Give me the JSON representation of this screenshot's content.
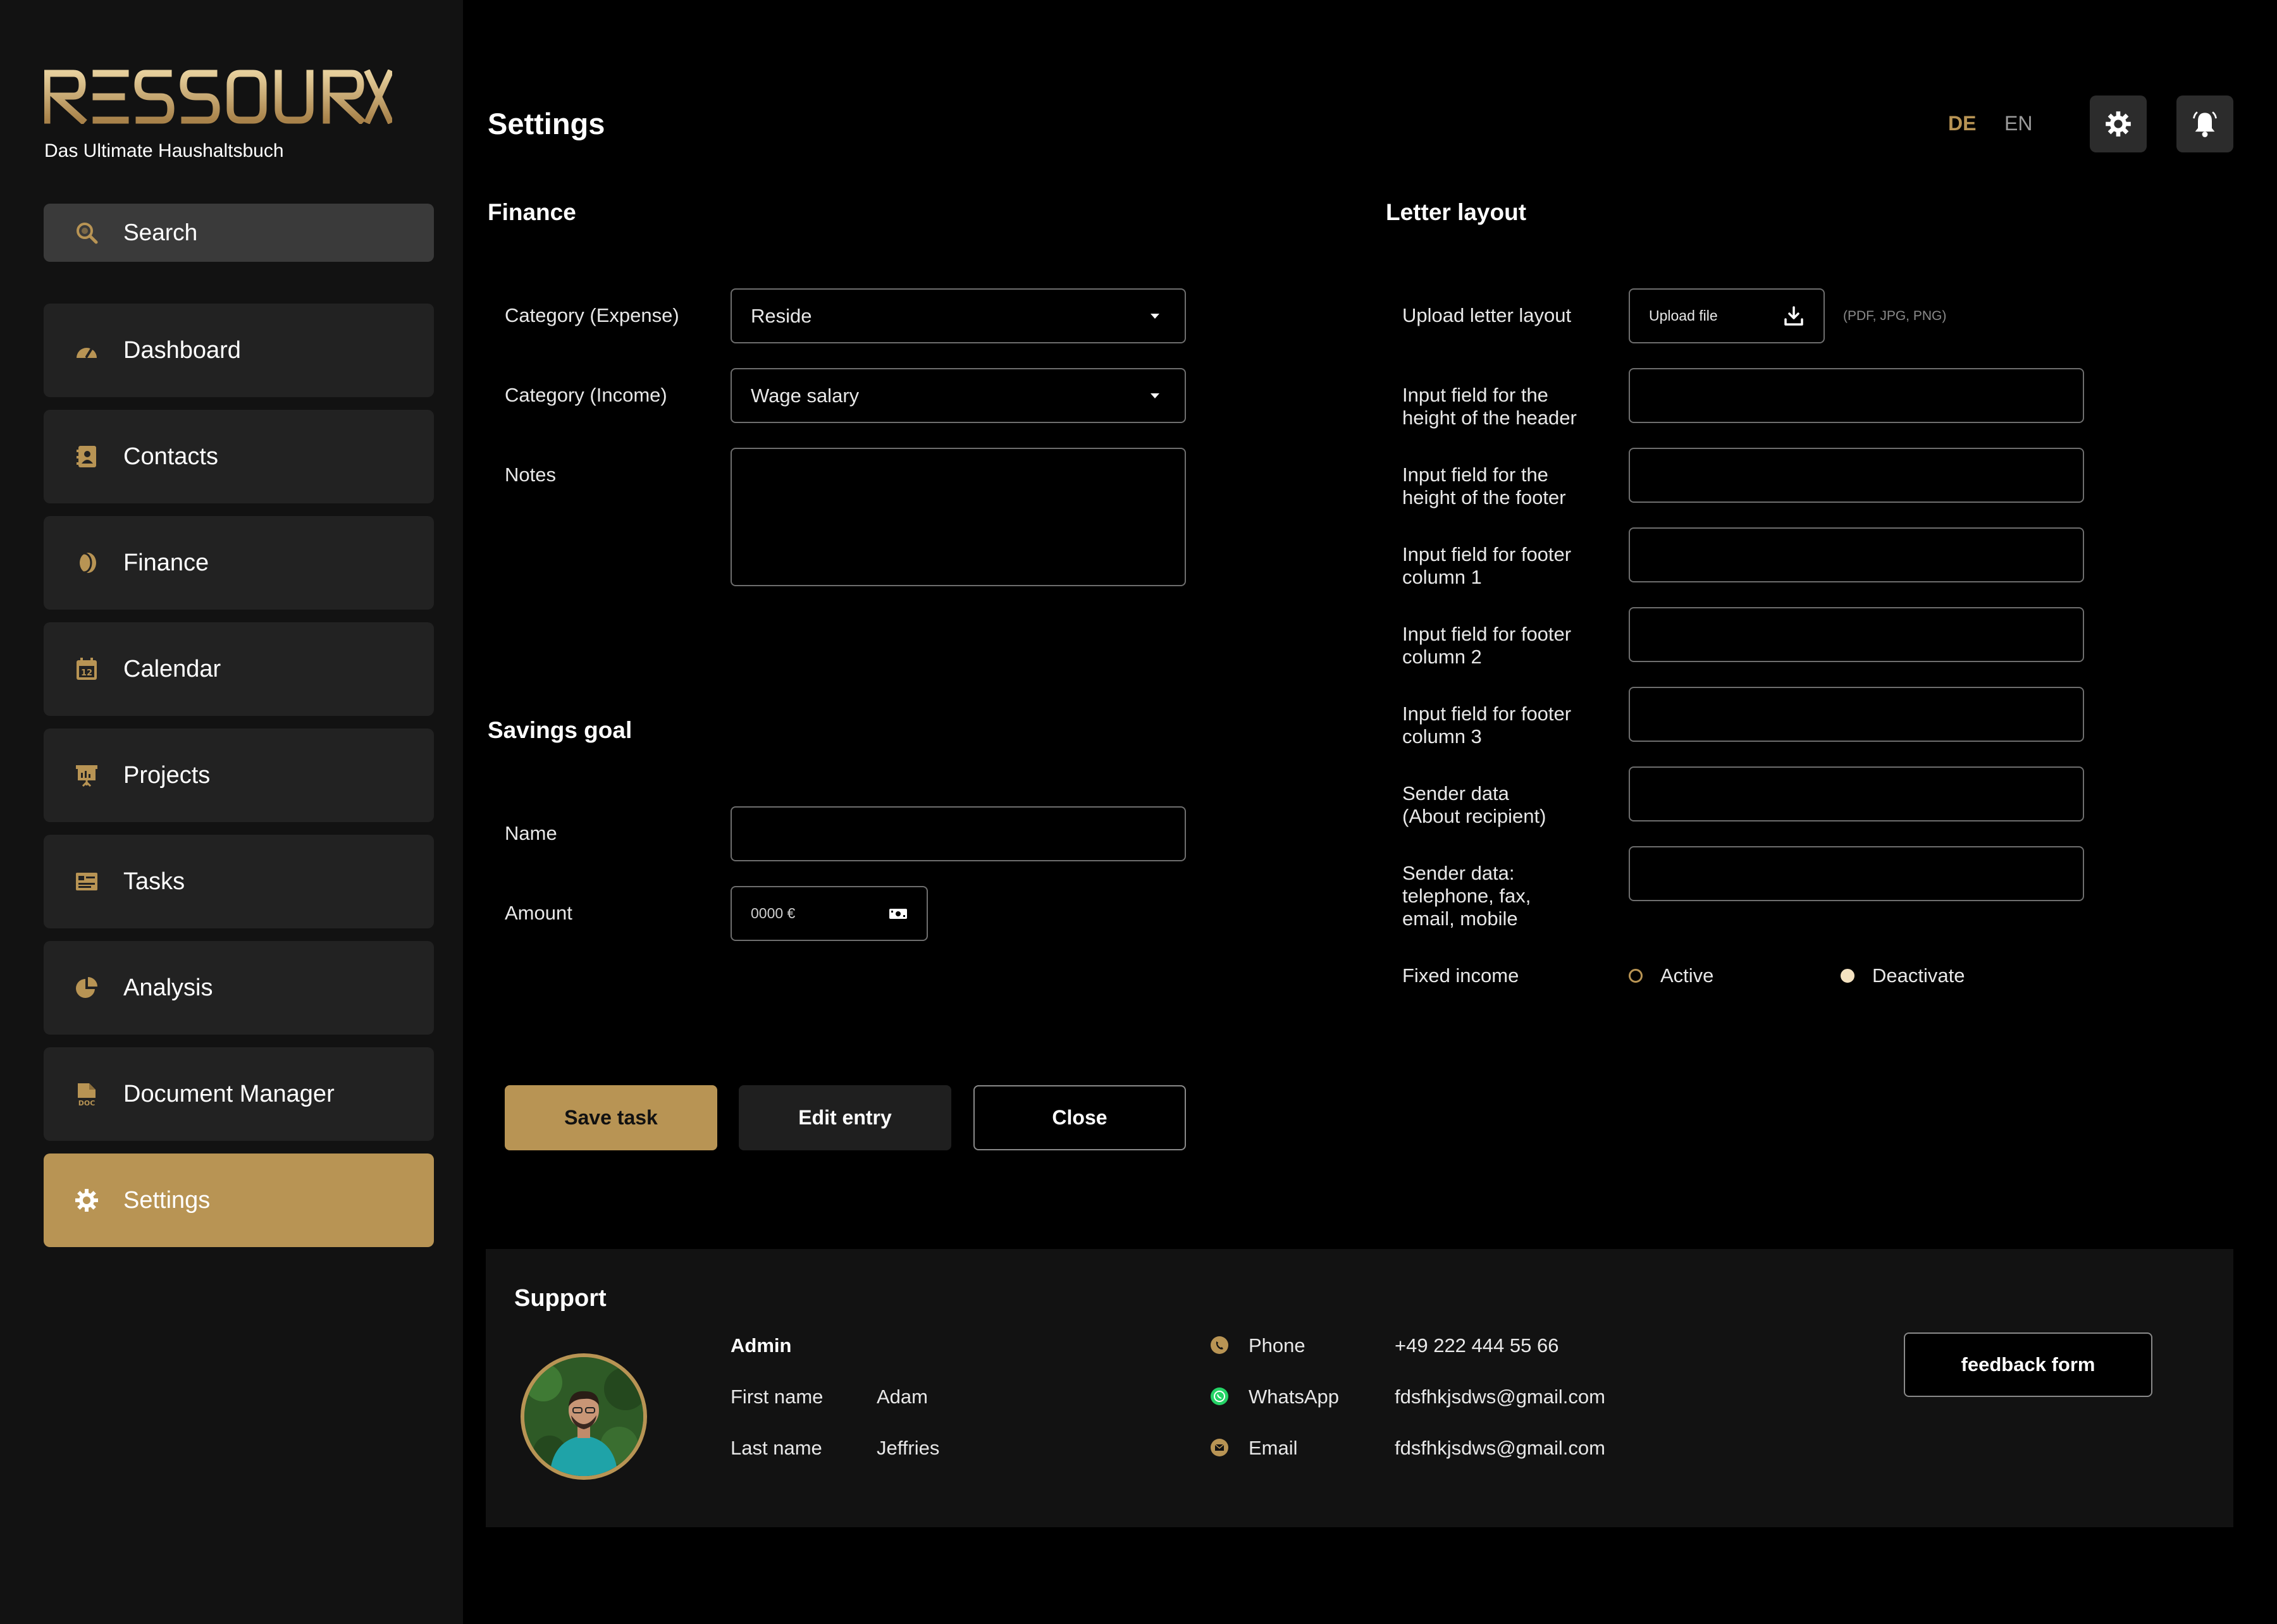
{
  "brand": {
    "logo_text": "RESSOURX",
    "tagline": "Das Ultimate Haushaltsbuch",
    "accent": "#b89454"
  },
  "sidebar": {
    "search_label": "Search",
    "items": [
      {
        "label": "Dashboard",
        "icon": "gauge-icon"
      },
      {
        "label": "Contacts",
        "icon": "contact-book-icon"
      },
      {
        "label": "Finance",
        "icon": "coins-icon"
      },
      {
        "label": "Calendar",
        "icon": "calendar-icon"
      },
      {
        "label": "Projects",
        "icon": "presentation-board-icon"
      },
      {
        "label": "Tasks",
        "icon": "task-list-icon"
      },
      {
        "label": "Analysis",
        "icon": "pie-chart-icon"
      },
      {
        "label": "Document Manager",
        "icon": "document-icon"
      },
      {
        "label": "Settings",
        "icon": "gear-icon",
        "active": true
      }
    ]
  },
  "header": {
    "title": "Settings",
    "lang_de": "DE",
    "lang_en": "EN",
    "active_lang": "DE"
  },
  "finance": {
    "title": "Finance",
    "category_expense_label": "Category (Expense)",
    "category_expense_value": "Reside",
    "category_income_label": "Category (Income)",
    "category_income_value": "Wage salary",
    "notes_label": "Notes"
  },
  "savings": {
    "title": "Savings goal",
    "name_label": "Name",
    "amount_label": "Amount",
    "amount_placeholder": "0000 €"
  },
  "letter": {
    "title": "Letter layout",
    "upload_label": "Upload letter layout",
    "upload_button": "Upload file",
    "upload_hint": "(PDF, JPG, PNG)",
    "fields": [
      {
        "line1": "Input field for the",
        "line2": "height of the header",
        "line3": ""
      },
      {
        "line1": "Input field for the",
        "line2": "height of the footer",
        "line3": ""
      },
      {
        "line1": "Input field for footer",
        "line2": "column 1",
        "line3": ""
      },
      {
        "line1": "Input field for footer",
        "line2": "column 2",
        "line3": ""
      },
      {
        "line1": "Input field for footer",
        "line2": "column 3",
        "line3": ""
      },
      {
        "line1": "Sender data",
        "line2": "(About recipient)",
        "line3": ""
      },
      {
        "line1": "Sender data:",
        "line2": "telephone, fax,",
        "line3": "email, mobile"
      }
    ],
    "fixed_income_label": "Fixed income",
    "radio_active": "Active",
    "radio_deactivate": "Deactivate",
    "selected": "Deactivate"
  },
  "actions": {
    "save": "Save task",
    "edit": "Edit entry",
    "close": "Close"
  },
  "support": {
    "title": "Support",
    "role": "Admin",
    "first_name_label": "First name",
    "first_name": "Adam",
    "last_name_label": "Last name",
    "last_name": "Jeffries",
    "phone_label": "Phone",
    "phone": "+49 222 444 55 66",
    "whatsapp_label": "WhatsApp",
    "whatsapp": "fdsfhkjsdws@gmail.com",
    "email_label": "Email",
    "email": "fdsfhkjsdws@gmail.com",
    "feedback": "feedback form"
  }
}
